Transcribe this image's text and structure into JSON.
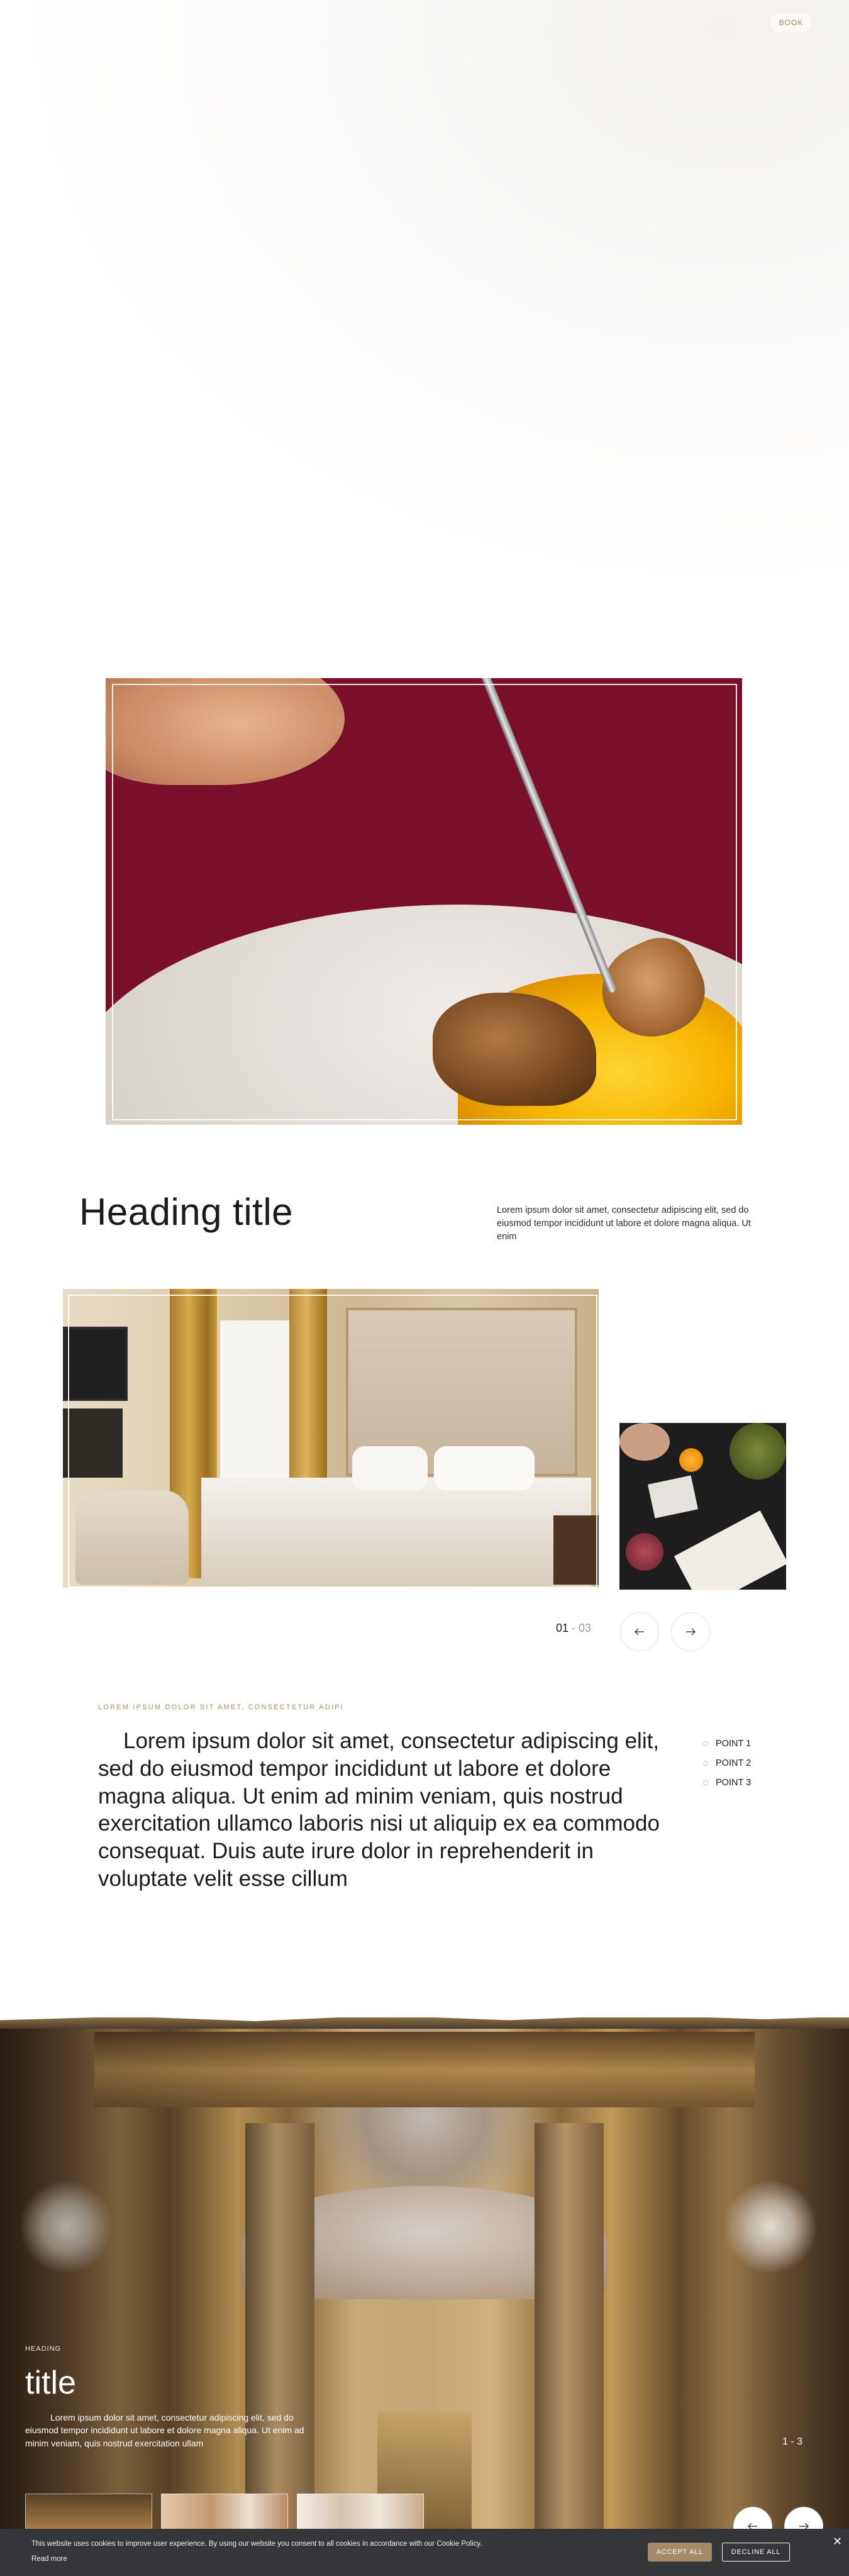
{
  "header": {
    "book_label": "BOOK"
  },
  "intro": {
    "heading": "Heading title",
    "description": "Lorem ipsum dolor sit amet, consectetur adipiscing elit, sed do eiusmod tempor incididunt ut labore et dolore magna aliqua. Ut enim"
  },
  "gallery": {
    "current": "01",
    "separator": " - ",
    "total": "03"
  },
  "content": {
    "eyebrow": "LOREM IPSUM DOLOR SIT AMET, CONSECTETUR ADIPI",
    "lead": "Lorem ipsum dolor sit amet, consectetur adipiscing elit, sed do eiusmod tempor incididunt ut labore et dolore magna aliqua. Ut enim ad minim veniam, quis nostrud exercitation ullamco laboris nisi ut aliquip ex ea commodo consequat. Duis aute irure dolor in reprehenderit in voluptate velit esse cillum",
    "points": [
      "POINT 1",
      "POINT 2",
      "POINT 3"
    ]
  },
  "slider": {
    "heading": "HEADING",
    "title": "title",
    "description": "Lorem ipsum dolor sit amet, consectetur adipiscing elit, sed do eiusmod tempor incididunt ut labore et dolore magna aliqua. Ut enim ad minim veniam, quis nostrud exercitation ullam",
    "counter": "1 - 3"
  },
  "cookie": {
    "text": "This website uses cookies to improve user experience. By using our website you consent to all cookies in accordance with our Cookie Policy.",
    "read_more": "Read more",
    "accept": "ACCEPT ALL",
    "decline": "DECLINE ALL",
    "close": "✕"
  },
  "icons": {
    "prev": "arrow-left-icon",
    "next": "arrow-right-icon",
    "bullet": "circle-bullet-icon",
    "close": "close-icon"
  },
  "colors": {
    "accent": "#b08a5d",
    "cookie_bg": "#35363a",
    "accept_bg": "#a48a66"
  }
}
